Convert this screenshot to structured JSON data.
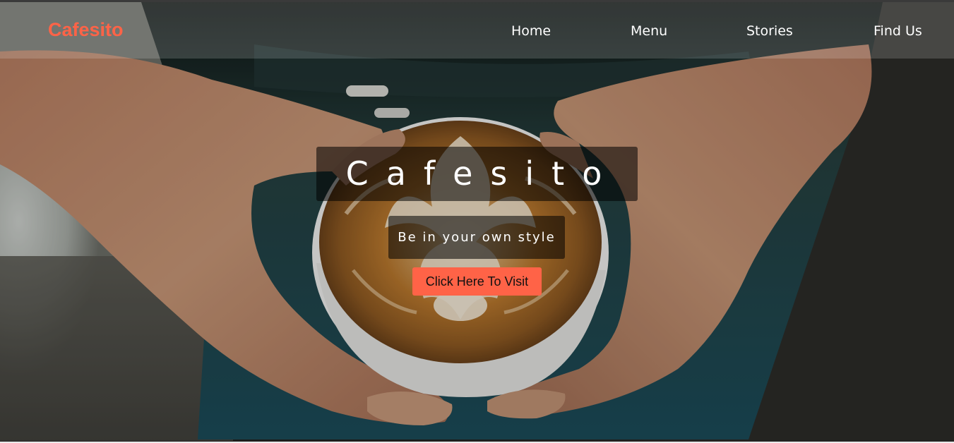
{
  "brand": {
    "logo_text": "Cafesito",
    "accent_color": "#ff6347"
  },
  "nav": {
    "items": [
      {
        "label": "Home"
      },
      {
        "label": "Menu"
      },
      {
        "label": "Stories"
      },
      {
        "label": "Find Us"
      }
    ]
  },
  "hero": {
    "title": "Cafesito",
    "tagline": "Be in your own style",
    "cta_label": "Click Here To Visit",
    "background_image": "hands-holding-latte-art-coffee-cup"
  }
}
